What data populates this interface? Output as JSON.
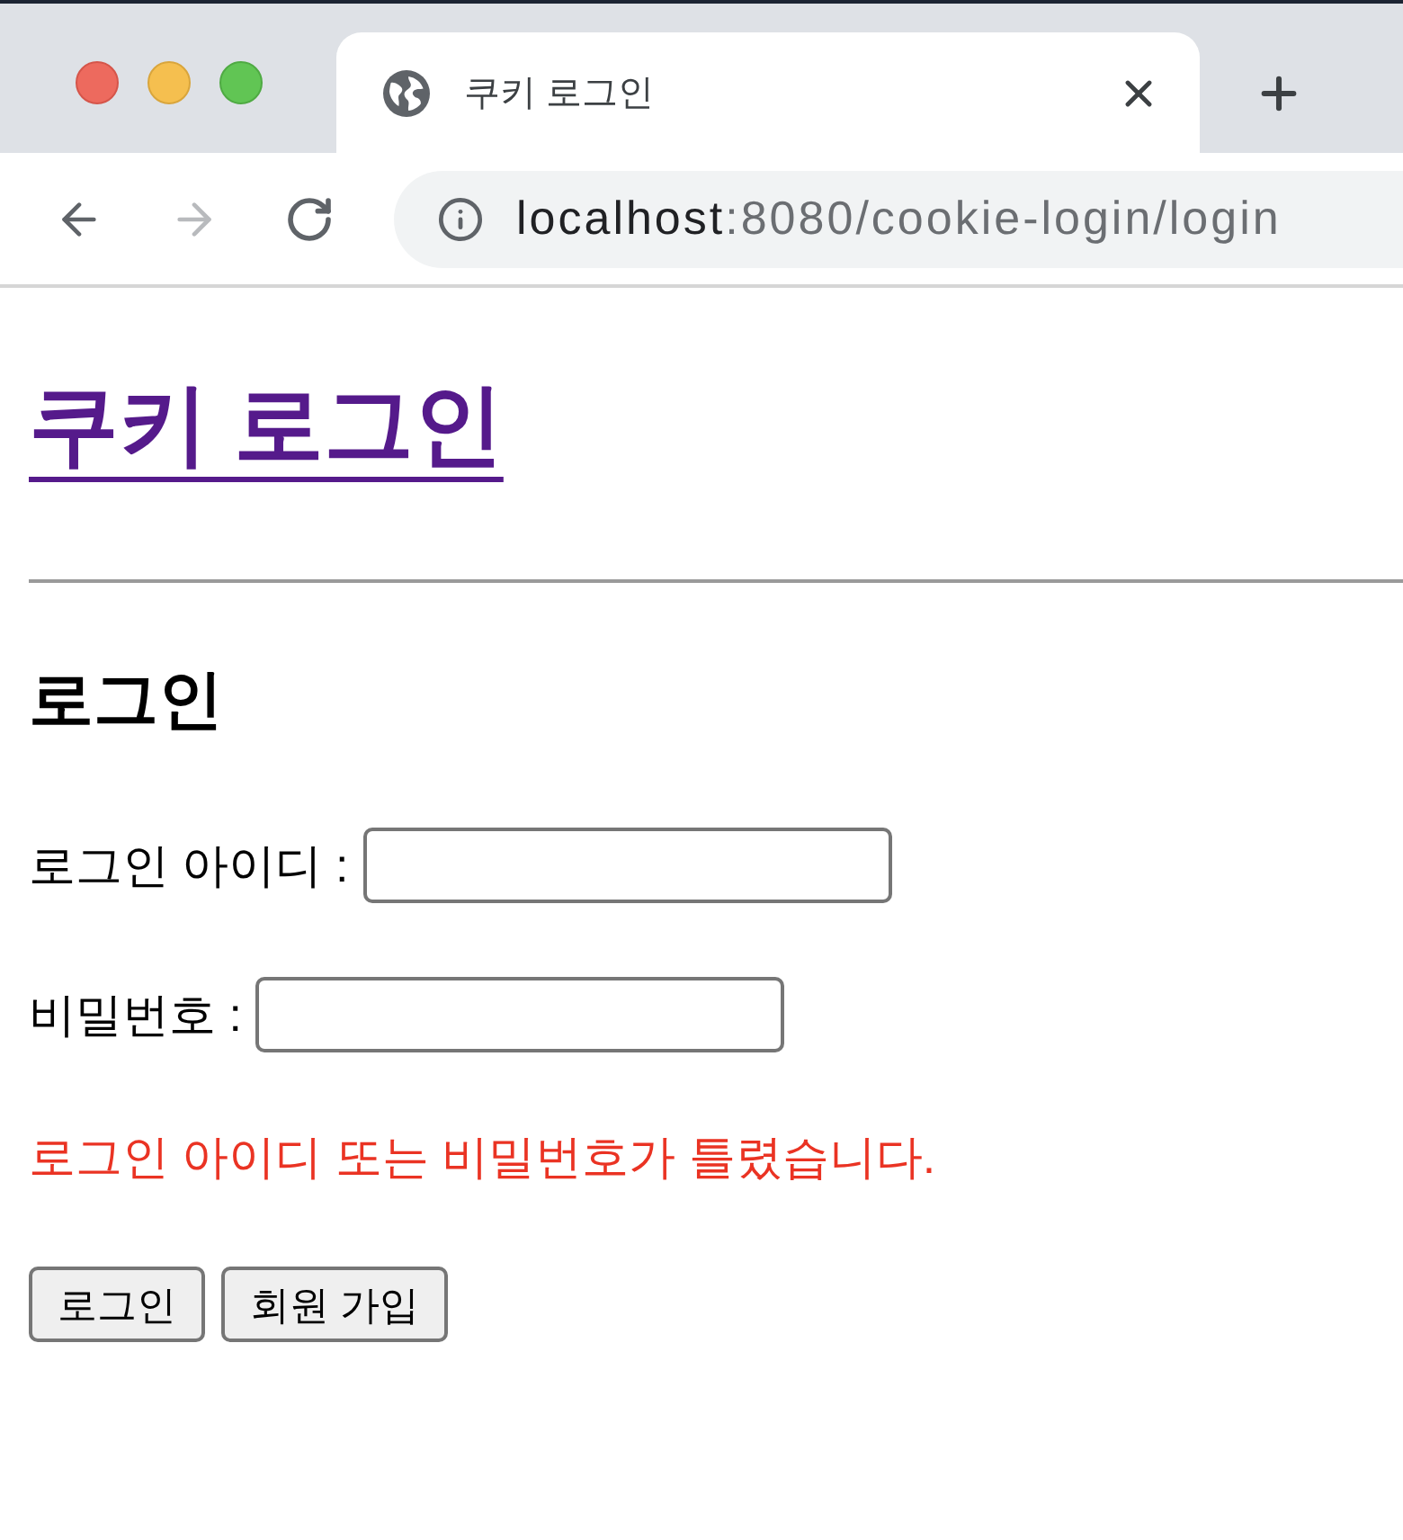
{
  "browser": {
    "tab": {
      "title": "쿠키 로그인",
      "selected": true
    },
    "nav_buttons": [
      {
        "kind": "back",
        "disabled": false
      },
      {
        "kind": "forward",
        "disabled": true
      },
      {
        "kind": "reload",
        "disabled": false
      }
    ],
    "address_bar": {
      "host": "localhost",
      "path": ":8080/cookie-login/login"
    }
  },
  "page": {
    "site_title": {
      "text": "쿠키 로그인",
      "visited": true
    },
    "heading": "로그인",
    "fields": [
      {
        "label": "로그인 아이디 :"
      },
      {
        "label": "비밀번호 :"
      }
    ],
    "error_message": "로그인 아이디 또는 비밀번호가 틀렸습니다.",
    "buttons": [
      "로그인",
      "회원 가입"
    ]
  }
}
